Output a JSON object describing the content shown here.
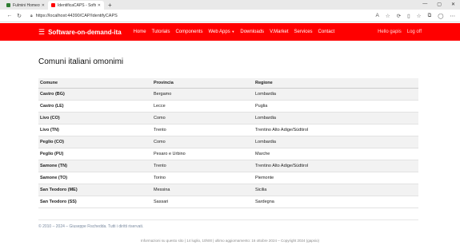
{
  "browser": {
    "tabs": [
      {
        "label": "Fulmini Homeotecia - Software on",
        "active": false,
        "favicon_color": "#2e7d32"
      },
      {
        "label": "IdentificaCAPS - Software-on-d",
        "active": true,
        "favicon_color": "#ff0000"
      }
    ],
    "new_tab": "+",
    "url": "https://localhost:44390/CAP/IdentifyCAPS",
    "window_controls": {
      "minimize": "—",
      "maximize": "▢",
      "close": "✕"
    }
  },
  "navbar": {
    "brand": "Software-on-demand-ita",
    "items": [
      "Home",
      "Tutorials",
      "Components",
      "Web Apps",
      "Downloads",
      "V.Market",
      "Services",
      "Contact"
    ],
    "right": {
      "greeting": "Hello gapis",
      "logout": "Log off"
    },
    "color": "#ff0000"
  },
  "main": {
    "heading": "Comuni italiani omonimi",
    "table": {
      "headers": [
        "Comune",
        "Provincia",
        "Regione"
      ],
      "rows": [
        [
          "Castro (BG)",
          "Bergamo",
          "Lombardia"
        ],
        [
          "Castro (LE)",
          "Lecce",
          "Puglia"
        ],
        [
          "Livo (CO)",
          "Como",
          "Lombardia"
        ],
        [
          "Livo (TN)",
          "Trento",
          "Trentino Alto Adige/Südtirol"
        ],
        [
          "Peglio (CO)",
          "Como",
          "Lombardia"
        ],
        [
          "Peglio (PU)",
          "Pesaro e Urbino",
          "Marche"
        ],
        [
          "Samone (TN)",
          "Trento",
          "Trentino Alto Adige/Südtirol"
        ],
        [
          "Samone (TO)",
          "Torino",
          "Piemonte"
        ],
        [
          "San Teodoro (ME)",
          "Messina",
          "Sicilia"
        ],
        [
          "San Teodoro (SS)",
          "Sassari",
          "Sardegna"
        ]
      ]
    }
  },
  "footer": {
    "copyright": "© 2010 – 2024 – Giuseppe Fischedda. Tutti i diritti riservati.",
    "note": "Informazioni su questo sito | 14 luglio, 10h00 | ultimo aggiornamento: 16 ottobre 2024 – Copyright 2024 (gapsio)"
  }
}
